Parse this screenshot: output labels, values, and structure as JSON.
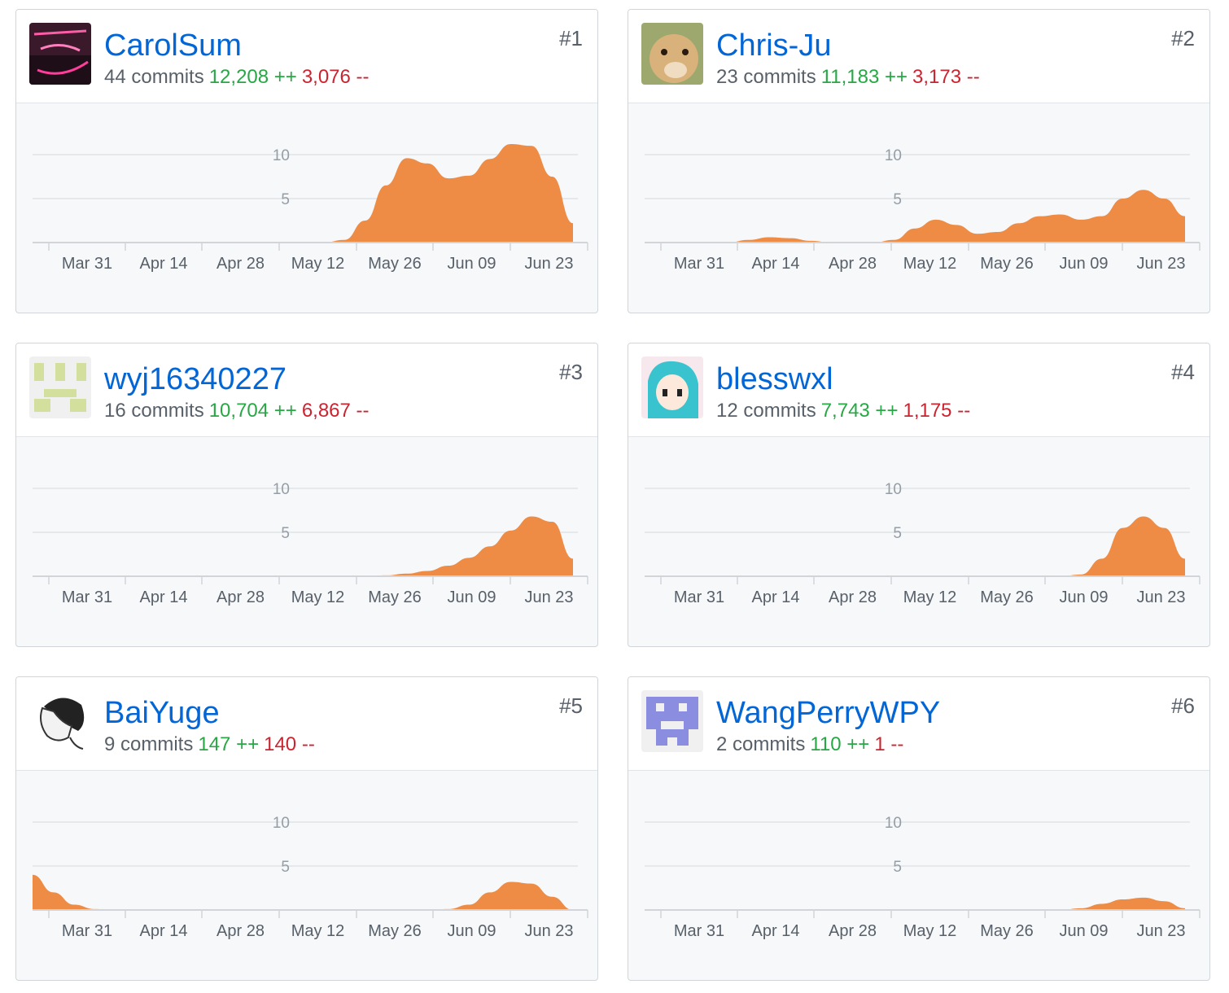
{
  "contributors": [
    {
      "name": "CarolSum",
      "rank": "#1",
      "commits": "44 commits",
      "additions": "12,208 ++",
      "deletions": "3,076 --",
      "avatar_icon": "neon-sign-avatar-icon"
    },
    {
      "name": "Chris-Ju",
      "rank": "#2",
      "commits": "23 commits",
      "additions": "11,183 ++",
      "deletions": "3,173 --",
      "avatar_icon": "guinea-pig-avatar-icon"
    },
    {
      "name": "wyj16340227",
      "rank": "#3",
      "commits": "16 commits",
      "additions": "10,704 ++",
      "deletions": "6,867 --",
      "avatar_icon": "identicon-avatar-icon"
    },
    {
      "name": "blesswxl",
      "rank": "#4",
      "commits": "12 commits",
      "additions": "7,743 ++",
      "deletions": "1,175 --",
      "avatar_icon": "anime-girl-avatar-icon"
    },
    {
      "name": "BaiYuge",
      "rank": "#5",
      "commits": "9 commits",
      "additions": "147 ++",
      "deletions": "140 --",
      "avatar_icon": "sketch-portrait-avatar-icon"
    },
    {
      "name": "WangPerryWPY",
      "rank": "#6",
      "commits": "2 commits",
      "additions": "110 ++",
      "deletions": "1 --",
      "avatar_icon": "identicon-avatar-icon"
    }
  ],
  "colors": {
    "area": "#ee8c45",
    "link": "#0366d6",
    "add": "#28a745",
    "del": "#cb2431"
  },
  "chart_data": [
    {
      "type": "area",
      "contributor": "CarolSum",
      "x": [
        "Mar 31",
        "Apr 14",
        "Apr 28",
        "May 12",
        "May 26",
        "Jun 09",
        "Jun 23"
      ],
      "yticks": [
        5,
        10
      ],
      "ylim": [
        0,
        12
      ],
      "series": [
        {
          "values": [
            0,
            0,
            0,
            0,
            0,
            0,
            0,
            0,
            0,
            0,
            0,
            0,
            0,
            0,
            0,
            0.3,
            2.5,
            6.5,
            9.6,
            9.0,
            7.3,
            7.6,
            9.5,
            11.2,
            11.0,
            7.5,
            2.2
          ]
        }
      ]
    },
    {
      "type": "area",
      "contributor": "Chris-Ju",
      "x": [
        "Mar 31",
        "Apr 14",
        "Apr 28",
        "May 12",
        "May 26",
        "Jun 09",
        "Jun 23"
      ],
      "yticks": [
        5,
        10
      ],
      "ylim": [
        0,
        12
      ],
      "series": [
        {
          "values": [
            0,
            0,
            0,
            0,
            0,
            0.3,
            0.6,
            0.5,
            0.2,
            0,
            0,
            0,
            0.3,
            1.6,
            2.6,
            2.0,
            1.0,
            1.2,
            2.2,
            3.0,
            3.2,
            2.6,
            3.0,
            5.0,
            6.0,
            5.0,
            3.0
          ]
        }
      ]
    },
    {
      "type": "area",
      "contributor": "wyj16340227",
      "x": [
        "Mar 31",
        "Apr 14",
        "Apr 28",
        "May 12",
        "May 26",
        "Jun 09",
        "Jun 23"
      ],
      "yticks": [
        5,
        10
      ],
      "ylim": [
        0,
        12
      ],
      "series": [
        {
          "values": [
            0,
            0,
            0,
            0,
            0,
            0,
            0,
            0,
            0,
            0,
            0,
            0,
            0,
            0,
            0,
            0,
            0,
            0.1,
            0.3,
            0.6,
            1.2,
            2.1,
            3.4,
            5.2,
            6.8,
            6.2,
            2.0
          ]
        }
      ]
    },
    {
      "type": "area",
      "contributor": "blesswxl",
      "x": [
        "Mar 31",
        "Apr 14",
        "Apr 28",
        "May 12",
        "May 26",
        "Jun 09",
        "Jun 23"
      ],
      "yticks": [
        5,
        10
      ],
      "ylim": [
        0,
        12
      ],
      "series": [
        {
          "values": [
            0,
            0,
            0,
            0,
            0,
            0,
            0,
            0,
            0,
            0,
            0,
            0,
            0,
            0,
            0,
            0,
            0,
            0,
            0,
            0,
            0,
            0.2,
            2.0,
            5.5,
            6.8,
            5.5,
            2.0
          ]
        }
      ]
    },
    {
      "type": "area",
      "contributor": "BaiYuge",
      "x": [
        "Mar 31",
        "Apr 14",
        "Apr 28",
        "May 12",
        "May 26",
        "Jun 09",
        "Jun 23"
      ],
      "yticks": [
        5,
        10
      ],
      "ylim": [
        0,
        12
      ],
      "series": [
        {
          "values": [
            4.0,
            2.0,
            0.6,
            0.1,
            0,
            0,
            0,
            0,
            0,
            0,
            0,
            0,
            0,
            0,
            0,
            0,
            0,
            0,
            0,
            0,
            0.1,
            0.6,
            2.0,
            3.2,
            3.0,
            1.5,
            0
          ]
        }
      ]
    },
    {
      "type": "area",
      "contributor": "WangPerryWPY",
      "x": [
        "Mar 31",
        "Apr 14",
        "Apr 28",
        "May 12",
        "May 26",
        "Jun 09",
        "Jun 23"
      ],
      "yticks": [
        5,
        10
      ],
      "ylim": [
        0,
        12
      ],
      "series": [
        {
          "values": [
            0,
            0,
            0,
            0,
            0,
            0,
            0,
            0,
            0,
            0,
            0,
            0,
            0,
            0,
            0,
            0,
            0,
            0,
            0,
            0,
            0,
            0.2,
            0.7,
            1.2,
            1.4,
            1.0,
            0.2
          ]
        }
      ]
    }
  ]
}
